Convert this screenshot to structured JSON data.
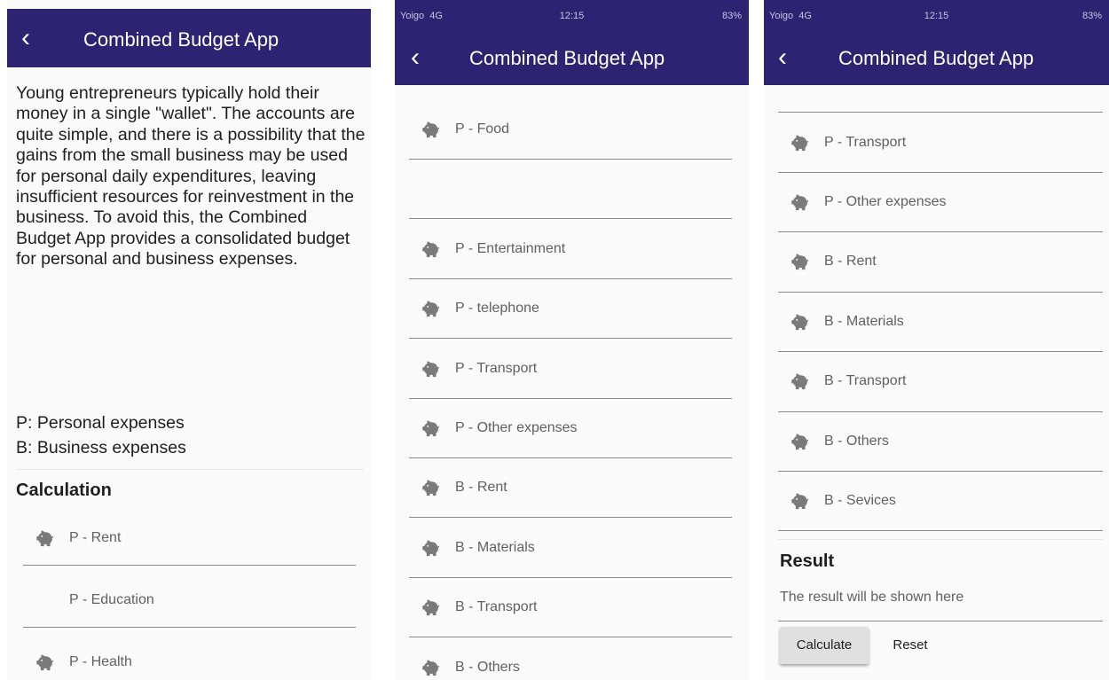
{
  "app_title": "Combined Budget App",
  "status_bar": {
    "carrier": "Yoigo",
    "network": "4G",
    "time": "12:15",
    "battery": "83%"
  },
  "intro_text": "Young entrepreneurs typically hold their money in a single \"wallet\". The accounts are quite simple, and there is a possibility that the gains from the small business may be used for personal daily expenditures, leaving insufficient resources for reinvestment in the business. To avoid this, the Combined Budget App provides a consolidated budget for personal and business expenses.",
  "legend": {
    "personal": "P: Personal expenses",
    "business": "B: Business expenses"
  },
  "calculation_heading": "Calculation",
  "screen1_fields": [
    {
      "label": "P - Rent",
      "icon": "piggy-bank-icon"
    },
    {
      "label": "P - Education",
      "icon": ""
    },
    {
      "label": "P - Health",
      "icon": "piggy-bank-icon"
    }
  ],
  "screen2_fields": [
    {
      "label": "P - Food",
      "icon": "piggy-bank-icon"
    },
    {
      "label": "",
      "icon": ""
    },
    {
      "label": "P - Entertainment",
      "icon": "piggy-bank-icon"
    },
    {
      "label": "P - telephone",
      "icon": "piggy-bank-icon"
    },
    {
      "label": "P - Transport",
      "icon": "piggy-bank-icon"
    },
    {
      "label": "P - Other expenses",
      "icon": "piggy-bank-icon"
    },
    {
      "label": "B - Rent",
      "icon": "piggy-bank-icon"
    },
    {
      "label": "B - Materials",
      "icon": "piggy-bank-icon"
    },
    {
      "label": "B - Transport",
      "icon": "piggy-bank-icon"
    },
    {
      "label": "B - Others",
      "icon": "piggy-bank-icon"
    }
  ],
  "screen3_fields": [
    {
      "label": "P - Transport",
      "icon": "piggy-bank-icon"
    },
    {
      "label": "P - Other expenses",
      "icon": "piggy-bank-icon"
    },
    {
      "label": "B - Rent",
      "icon": "piggy-bank-icon"
    },
    {
      "label": "B - Materials",
      "icon": "piggy-bank-icon"
    },
    {
      "label": "B - Transport",
      "icon": "piggy-bank-icon"
    },
    {
      "label": "B - Others",
      "icon": "piggy-bank-icon"
    },
    {
      "label": "B - Sevices",
      "icon": "piggy-bank-icon"
    }
  ],
  "result": {
    "heading": "Result",
    "placeholder": "The result will be shown here"
  },
  "buttons": {
    "calculate": "Calculate",
    "reset": "Reset"
  },
  "colors": {
    "app_bar": "#2d2373",
    "background": "#fafafa",
    "icon": "#7a7a7a",
    "button": "#e0e0e0"
  }
}
